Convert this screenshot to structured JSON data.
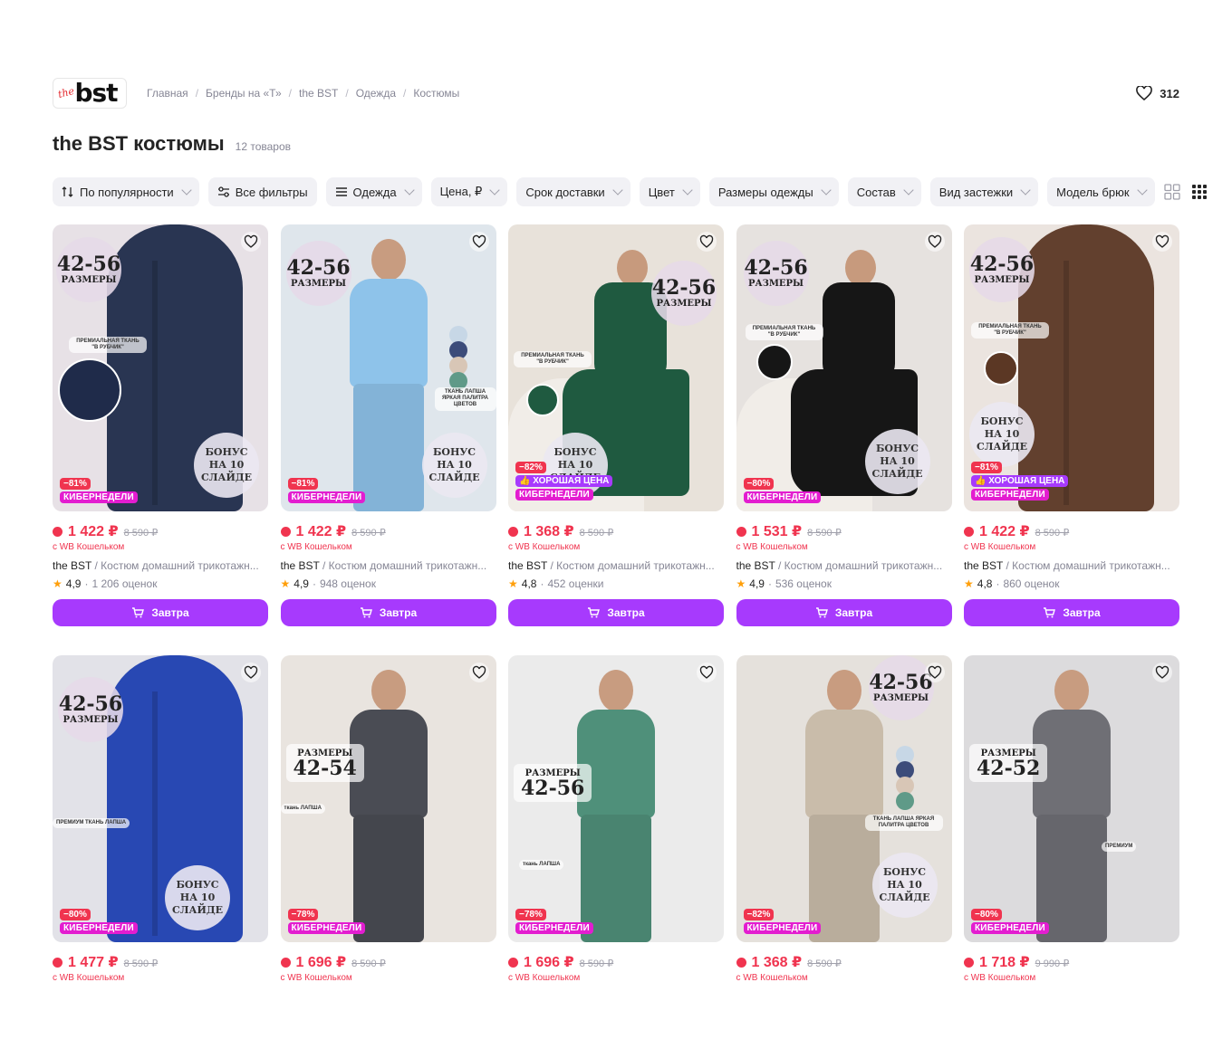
{
  "brand": {
    "logo_small": "the",
    "logo_big": "bst"
  },
  "breadcrumb": [
    "Главная",
    "Бренды на «Т»",
    "the BST",
    "Одежда",
    "Костюмы"
  ],
  "favorites": {
    "count": "312"
  },
  "page": {
    "title": "the BST костюмы",
    "count": "12 товаров"
  },
  "filters": [
    {
      "label": "По популярности",
      "icon": "sort-icon"
    },
    {
      "label": "Все фильтры",
      "icon": "sliders-icon"
    },
    {
      "label": "Одежда",
      "icon": "menu-icon"
    },
    {
      "label": "Цена, ₽"
    },
    {
      "label": "Срок доставки"
    },
    {
      "label": "Цвет"
    },
    {
      "label": "Размеры одежды"
    },
    {
      "label": "Состав"
    },
    {
      "label": "Вид застежки"
    },
    {
      "label": "Модель брюк"
    }
  ],
  "common": {
    "wallet": "с WB Кошельком",
    "buy": "Завтра",
    "cyber": "КИБЕРНЕДЕЛИ",
    "good_price": "ХОРОШАЯ ЦЕНА",
    "bonus": [
      "БОНУС",
      "НА 10",
      "СЛАЙДЕ"
    ],
    "sizes_label": "РАЗМЕРЫ"
  },
  "products": [
    {
      "price": "1 422 ₽",
      "old": "8 590 ₽",
      "brand": "the BST",
      "name": "Костюм домашний трикотажн...",
      "rating": "4,9",
      "reviews": "1 206 оценок",
      "discount": "−81%",
      "good": false,
      "sizes": "42-56",
      "note": "ПРЕМИАЛЬНАЯ ТКАНЬ \"В РУБЧИК\"",
      "bg": "#e7e1e6",
      "cloth": "#1f2b4a"
    },
    {
      "price": "1 422 ₽",
      "old": "8 590 ₽",
      "brand": "the BST",
      "name": "Костюм домашний трикотажн...",
      "rating": "4,9",
      "reviews": "948 оценок",
      "discount": "−81%",
      "good": false,
      "sizes": "42-56",
      "note": "ТКАНЬ ЛАПША ЯРКАЯ ПАЛИТРА ЦВЕТОВ",
      "bg": "#dfe6ec",
      "cloth": "#8ec3ea"
    },
    {
      "price": "1 368 ₽",
      "old": "8 590 ₽",
      "brand": "the BST",
      "name": "Костюм домашний трикотажн...",
      "rating": "4,8",
      "reviews": "452 оценки",
      "discount": "−82%",
      "good": true,
      "sizes": "42-56",
      "note": "ПРЕМИАЛЬНАЯ ТКАНЬ \"В РУБЧИК\"",
      "bg": "#e8e2da",
      "cloth": "#1f5a40"
    },
    {
      "price": "1 531 ₽",
      "old": "8 590 ₽",
      "brand": "the BST",
      "name": "Костюм домашний трикотажн...",
      "rating": "4,9",
      "reviews": "536 оценок",
      "discount": "−80%",
      "good": false,
      "sizes": "42-56",
      "note": "ПРЕМИАЛЬНАЯ ТКАНЬ \"В РУБЧИК\"",
      "bg": "#e6e2df",
      "cloth": "#161616"
    },
    {
      "price": "1 422 ₽",
      "old": "8 590 ₽",
      "brand": "the BST",
      "name": "Костюм домашний трикотажн...",
      "rating": "4,8",
      "reviews": "860 оценок",
      "discount": "−81%",
      "good": true,
      "sizes": "42-56",
      "note": "ПРЕМИАЛЬНАЯ ТКАНЬ \"В РУБЧИК\"",
      "bg": "#ebe4df",
      "cloth": "#5b3724"
    },
    {
      "price": "1 477 ₽",
      "old": "8 590 ₽",
      "discount": "−80%",
      "sizes": "42-56",
      "note": "ПРЕМИУМ ТКАНЬ ЛАПША",
      "bg": "#e2e2e8",
      "cloth": "#1d3fb0"
    },
    {
      "price": "1 696 ₽",
      "old": "8 590 ₽",
      "discount": "−78%",
      "sizes": "42-54",
      "note": "ткань ЛАПША",
      "bg": "#e9e4df",
      "cloth": "#4a4c54"
    },
    {
      "price": "1 696 ₽",
      "old": "8 590 ₽",
      "discount": "−78%",
      "sizes": "42-56",
      "note": "ткань ЛАПША",
      "bg": "#ebebeb",
      "cloth": "#4f907a"
    },
    {
      "price": "1 368 ₽",
      "old": "8 590 ₽",
      "discount": "−82%",
      "sizes": "42-56",
      "note": "ТКАНЬ ЛАПША ЯРКАЯ ПАЛИТРА ЦВЕТОВ",
      "bg": "#e5e1dc",
      "cloth": "#c9bcaa"
    },
    {
      "price": "1 718 ₽",
      "old": "9 990 ₽",
      "discount": "−80%",
      "sizes": "42-52",
      "note": "ПРЕМИУМ",
      "bg": "#dcdbdd",
      "cloth": "#6f6f75"
    }
  ]
}
